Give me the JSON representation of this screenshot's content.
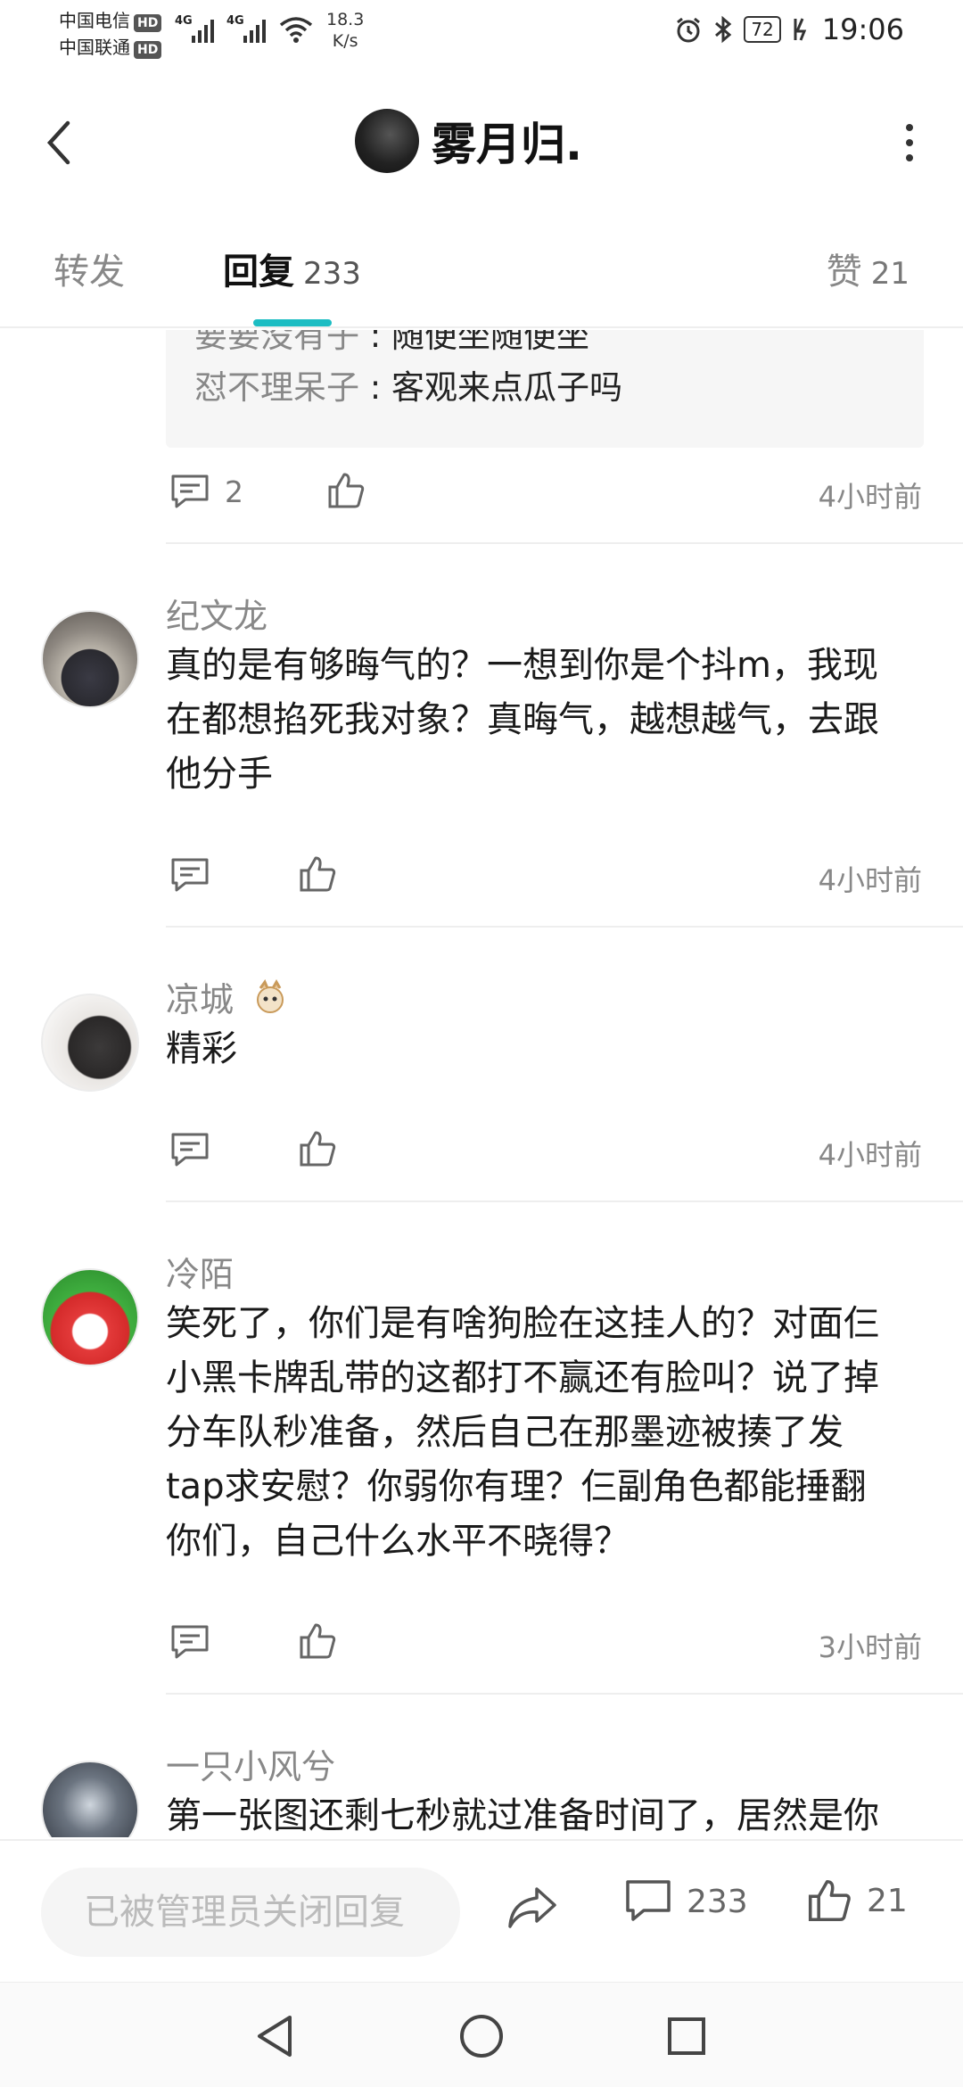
{
  "status_bar": {
    "carrier1": "中国电信",
    "carrier2": "中国联通",
    "hd": "HD",
    "net1": "4G",
    "net2": "4G",
    "speed_value": "18.3",
    "speed_unit": "K/s",
    "battery": "72",
    "time": "19:06"
  },
  "header": {
    "title": "雾月归."
  },
  "tabs": {
    "repost_label": "转发",
    "reply_label": "回复",
    "reply_count": "233",
    "like_label": "赞",
    "like_count": "21"
  },
  "top_thread": {
    "quote_partial_name": "要要没有子",
    "quote_partial_text": "随便坐随便坐",
    "quote_name": "怼不理呆子",
    "quote_text": "客观来点瓜子吗",
    "reply_count": "2",
    "time": "4小时前"
  },
  "comments": [
    {
      "name": "纪文龙",
      "lines": [
        "真的是有够晦气的？一想到你是个抖m，我现",
        "在都想掐死我对象？真晦气，越想越气，去跟",
        "他分手"
      ],
      "time": "4小时前"
    },
    {
      "name": "凉城",
      "lines": [
        "精彩"
      ],
      "time": "4小时前"
    },
    {
      "name": "冷陌",
      "lines": [
        "笑死了，你们是有啥狗脸在这挂人的？对面仨",
        "小黑卡牌乱带的这都打不赢还有脸叫？说了掉",
        "分车队秒准备，然后自己在那墨迹被揍了发",
        "tap求安慰？你弱你有理？仨副角色都能捶翻",
        "你们，自己什么水平不晓得？"
      ],
      "time": "3小时前"
    },
    {
      "name": "一只小风兮",
      "lines": [
        "第一张图还剩七秒就过准备时间了，居然是你"
      ],
      "time": ""
    }
  ],
  "bottom_bar": {
    "input_placeholder": "已被管理员关闭回复",
    "comment_count": "233",
    "like_count": "21"
  },
  "colors": {
    "accent": "#1cbdc3",
    "muted_text": "#888888",
    "body_text": "#1a1a1a"
  }
}
